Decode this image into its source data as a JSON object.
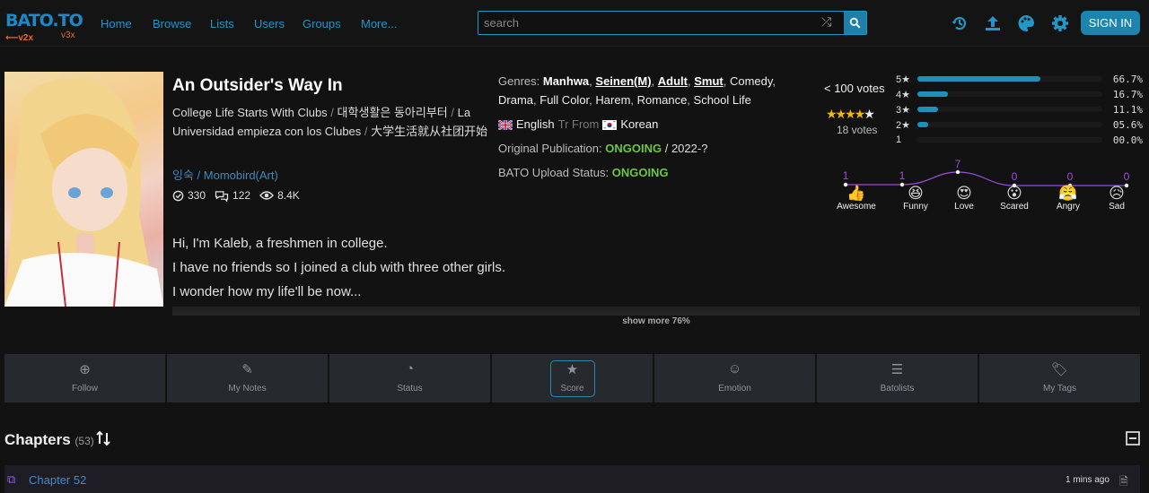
{
  "brand": {
    "logo": "BATO.TO",
    "v2": "⟵v2x",
    "v3": "v3x"
  },
  "nav": [
    "Home",
    "Browse",
    "Lists",
    "Users",
    "Groups",
    "More..."
  ],
  "search": {
    "placeholder": "search"
  },
  "header_icons": [
    "history-icon",
    "upload-icon",
    "palette-icon",
    "gear-icon"
  ],
  "signin": "SIGN IN",
  "comic": {
    "title": "An Outsider's Way In",
    "alt_titles": [
      "College Life Starts With Clubs",
      "대학생활은 동아리부터",
      "La Universidad empieza con los Clubes",
      "大学生活就从社团开始"
    ],
    "authors": "잉숙 / Momobird(Art)",
    "stats": {
      "followers": "330",
      "comments": "122",
      "views": "8.4K"
    },
    "description": [
      "Hi, I'm Kaleb, a freshmen in college.",
      "I have no friends so I joined a club with three other girls.",
      "I wonder how my life'll be now..."
    ],
    "show_more": "show more 76%"
  },
  "meta": {
    "genres_label": "Genres:",
    "genres": [
      "Manhwa",
      "Seinen(M)",
      "Adult",
      "Smut",
      "Comedy",
      "Drama",
      "Full Color",
      "Harem",
      "Romance",
      "School Life"
    ],
    "lang_from": "English",
    "tr_from": "Tr From",
    "lang_to": "Korean",
    "orig_label": "Original Publication:",
    "orig_status": "ONGOING",
    "orig_year": "/ 2022-?",
    "upload_label": "BATO Upload Status:",
    "upload_status": "ONGOING"
  },
  "rating": {
    "votes": "< 100 votes",
    "count": "18 votes",
    "stars_value": 4.3,
    "rows": [
      {
        "label": "5★",
        "pct": "66.7%",
        "value": 66.7
      },
      {
        "label": "4★",
        "pct": "16.7%",
        "value": 16.7
      },
      {
        "label": "3★",
        "pct": "11.1%",
        "value": 11.1
      },
      {
        "label": "2★",
        "pct": "05.6%",
        "value": 5.6
      },
      {
        "label": "1",
        "pct": "00.0%",
        "value": 0
      }
    ]
  },
  "emotions": [
    {
      "name": "Awesome",
      "count": "1"
    },
    {
      "name": "Funny",
      "count": "1"
    },
    {
      "name": "Love",
      "count": "7"
    },
    {
      "name": "Scared",
      "count": "0"
    },
    {
      "name": "Angry",
      "count": "0"
    },
    {
      "name": "Sad",
      "count": "0"
    }
  ],
  "actions": [
    "Follow",
    "My Notes",
    "Status",
    "Score",
    "Emotion",
    "Batolists",
    "My Tags"
  ],
  "chapters": {
    "title": "Chapters",
    "count": "(53)",
    "first": {
      "name": "Chapter 52",
      "time": "1 mins ago"
    }
  },
  "colors": {
    "accent": "#1f98c9",
    "green": "#6cc644",
    "purple": "#9c4dde"
  }
}
